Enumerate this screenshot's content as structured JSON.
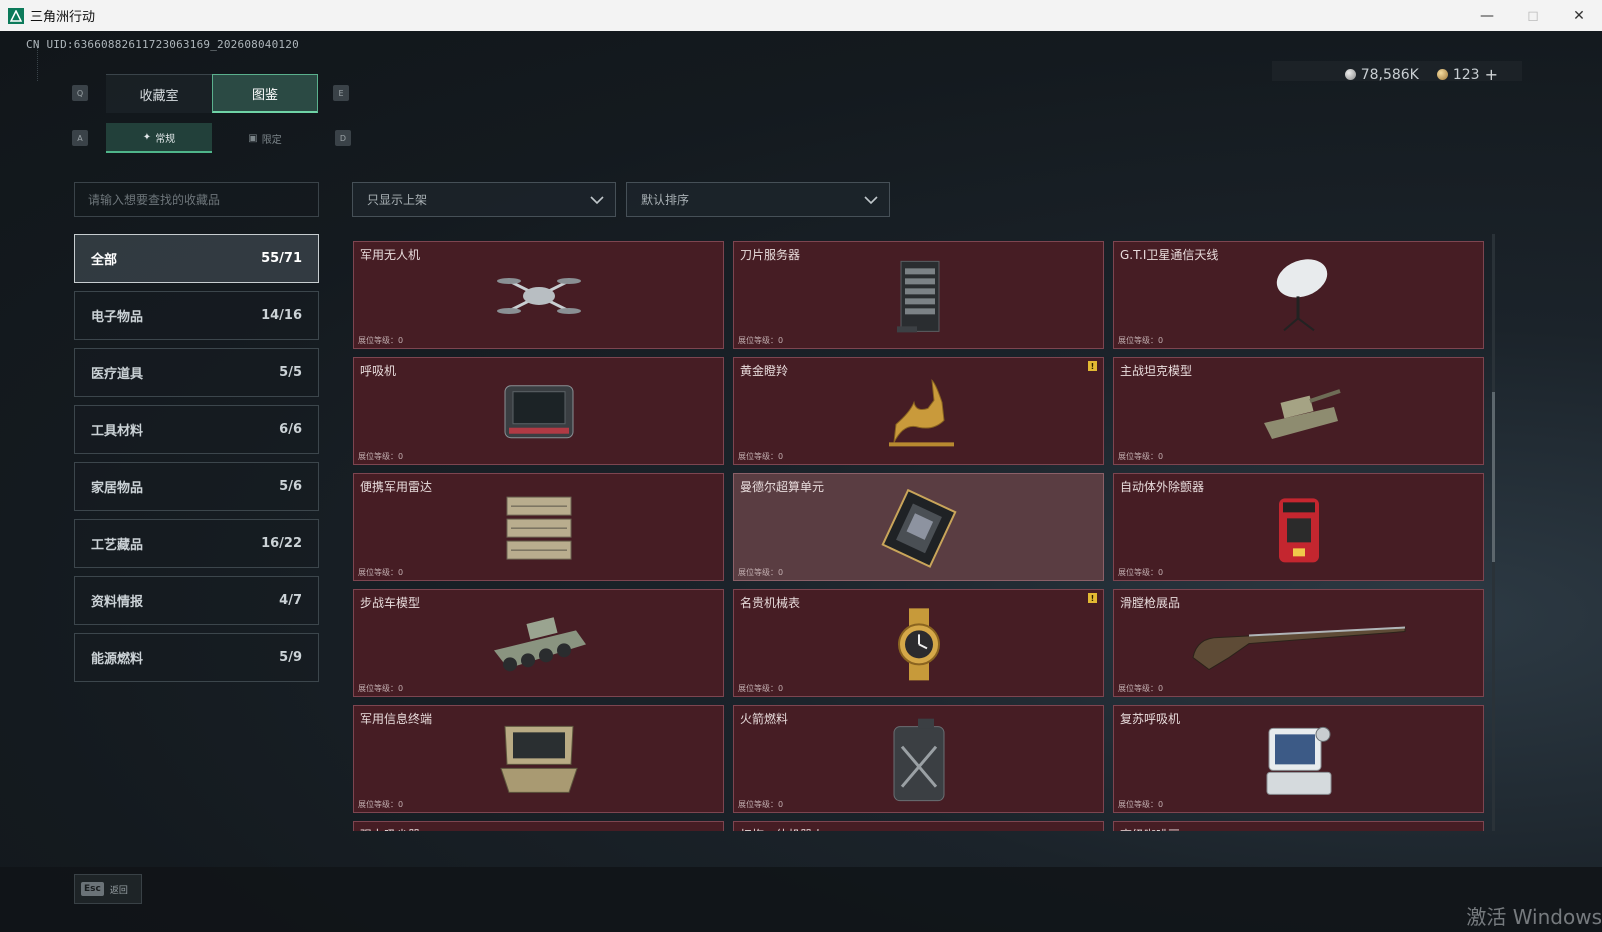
{
  "window": {
    "title": "三角洲行动",
    "controls": [
      "minimize-icon",
      "maximize-icon",
      "close-icon"
    ]
  },
  "header": {
    "uid": "CN UID:6366088261172306316​9_202608040120",
    "silver": "78,586K",
    "gold": "123",
    "add": "+"
  },
  "main_tabs": [
    {
      "label": "收藏室",
      "active": false
    },
    {
      "label": "图鉴",
      "active": true
    }
  ],
  "sub_tabs": [
    {
      "label": "常规",
      "icon": "flame-icon",
      "active": true
    },
    {
      "label": "限定",
      "icon": "image-icon",
      "active": false
    }
  ],
  "key_hints": {
    "q": "Q",
    "e": "E",
    "a": "A",
    "d": "D"
  },
  "search": {
    "placeholder": "请输入想要查找的收藏品"
  },
  "filters": {
    "display": "只显示上架",
    "sort": "默认排序"
  },
  "categories": [
    {
      "label": "全部",
      "count": "55/71",
      "active": true
    },
    {
      "label": "电子物品",
      "count": "14/16"
    },
    {
      "label": "医疗道具",
      "count": "5/5"
    },
    {
      "label": "工具材料",
      "count": "6/6"
    },
    {
      "label": "家居物品",
      "count": "5/6"
    },
    {
      "label": "工艺藏品",
      "count": "16/22"
    },
    {
      "label": "资料情报",
      "count": "4/7"
    },
    {
      "label": "能源燃料",
      "count": "5/9"
    }
  ],
  "level_label": "展位等级：0",
  "items": [
    {
      "name": "军用无人机",
      "icon": "drone-icon"
    },
    {
      "name": "刀片服务器",
      "icon": "server-icon"
    },
    {
      "name": "G.T.I卫星通信天线",
      "icon": "satellite-dish-icon"
    },
    {
      "name": "呼吸机",
      "icon": "ventilator-icon"
    },
    {
      "name": "黄金瞪羚",
      "icon": "golden-gazelle-icon",
      "badge": "!"
    },
    {
      "name": "主战坦克模型",
      "icon": "tank-model-icon"
    },
    {
      "name": "便携军用雷达",
      "icon": "radar-icon"
    },
    {
      "name": "曼德尔超算单元",
      "icon": "supercomputer-chip-icon",
      "highlight": true
    },
    {
      "name": "自动体外除颤器",
      "icon": "defibrillator-icon"
    },
    {
      "name": "步战车模型",
      "icon": "ifv-model-icon"
    },
    {
      "name": "名贵机械表",
      "icon": "watch-icon",
      "badge": "!"
    },
    {
      "name": "滑膛枪展品",
      "icon": "musket-icon"
    },
    {
      "name": "军用信息终端",
      "icon": "terminal-icon"
    },
    {
      "name": "火箭燃料",
      "icon": "fuel-can-icon"
    },
    {
      "name": "复苏呼吸机",
      "icon": "resuscitator-icon"
    },
    {
      "name": "强力吸尘器",
      "icon": "vacuum-icon"
    },
    {
      "name": "扫拖一体机器人",
      "icon": "robot-vacuum-icon"
    },
    {
      "name": "高级咖啡豆",
      "icon": "coffee-icon"
    }
  ],
  "footer": {
    "esc_key": "Esc",
    "esc_label": "返回"
  },
  "watermark": "激活 Windows",
  "colors": {
    "card_bg": "#461d24",
    "card_border": "#7d4550",
    "accent": "#4fb58a"
  }
}
